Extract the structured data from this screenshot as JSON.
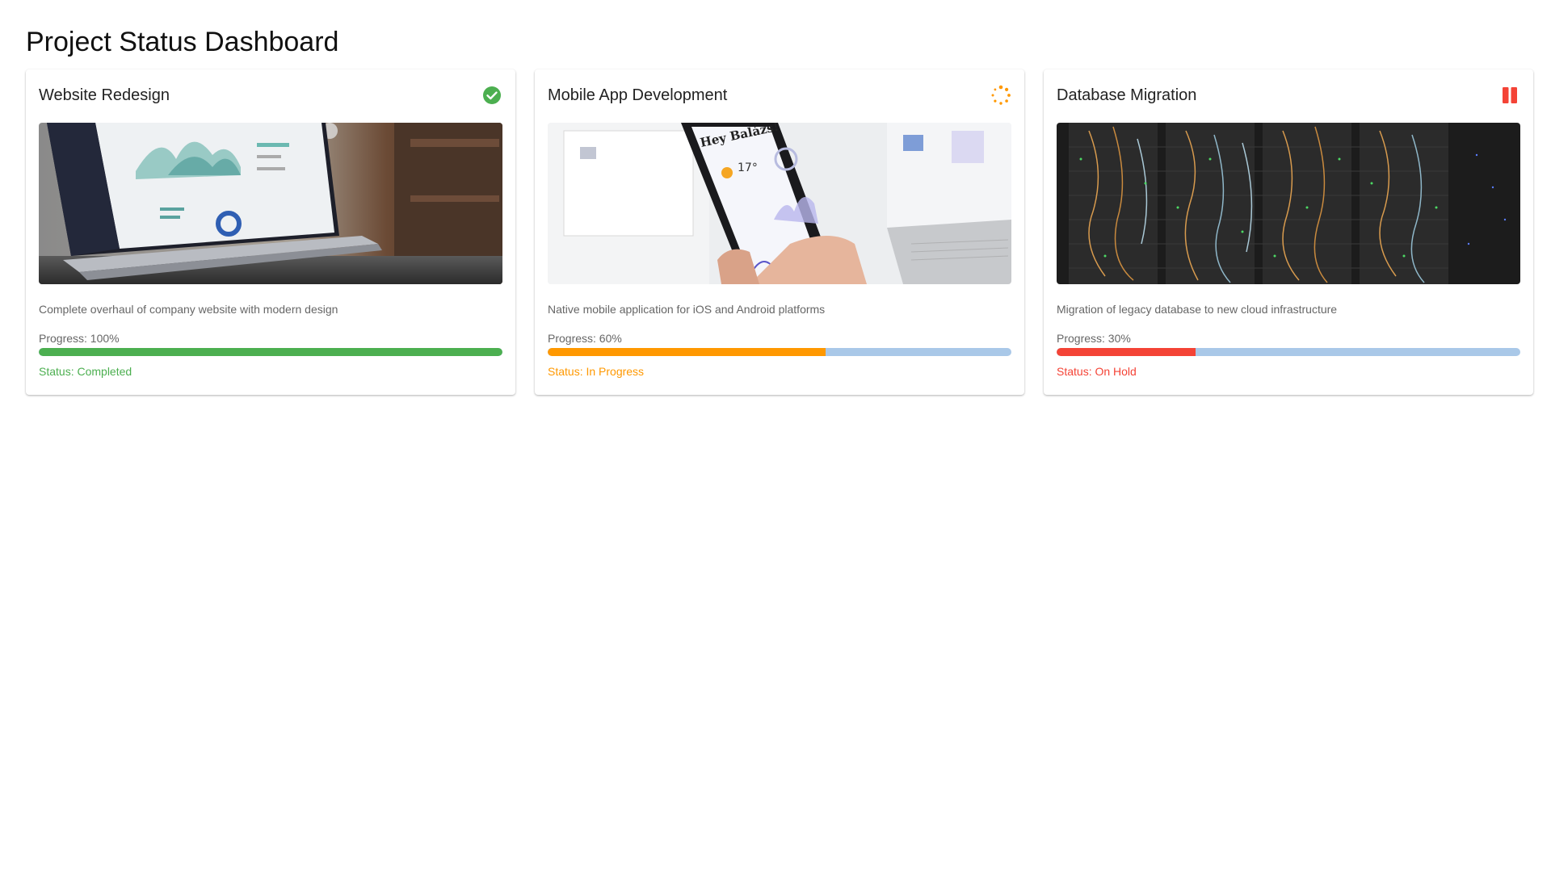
{
  "page": {
    "title": "Project Status Dashboard"
  },
  "colors": {
    "completed": "#4caf50",
    "in_progress": "#ff9800",
    "on_hold": "#f44336",
    "track": "#a9c8e8"
  },
  "projects": [
    {
      "title": "Website Redesign",
      "status_icon": "check-circle-icon",
      "image": "laptop-analytics-photo",
      "description": "Complete overhaul of company website with modern design",
      "progress_label": "Progress: 100%",
      "progress": 100,
      "status_label": "Status: Completed",
      "color": "#4caf50"
    },
    {
      "title": "Mobile App Development",
      "status_icon": "loading-spinner-icon",
      "image": "phone-app-photo",
      "description": "Native mobile application for iOS and Android platforms",
      "progress_label": "Progress: 60%",
      "progress": 60,
      "status_label": "Status: In Progress",
      "color": "#ff9800"
    },
    {
      "title": "Database Migration",
      "status_icon": "pause-icon",
      "image": "server-rack-photo",
      "description": "Migration of legacy database to new cloud infrastructure",
      "progress_label": "Progress: 30%",
      "progress": 30,
      "status_label": "Status: On Hold",
      "color": "#f44336"
    }
  ]
}
